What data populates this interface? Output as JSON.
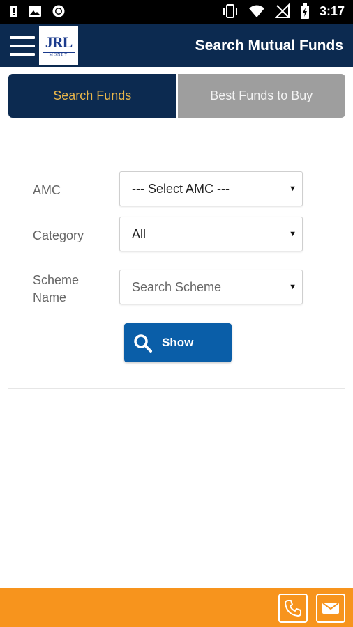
{
  "status_bar": {
    "time": "3:17",
    "left_icons": [
      "alert-icon",
      "image-icon",
      "circle-icon"
    ],
    "right_icons": [
      "vibrate-icon",
      "wifi-icon",
      "no-signal-icon",
      "battery-icon"
    ]
  },
  "header": {
    "logo_text": "JRL",
    "logo_subtext": "MONEY",
    "title": "Search Mutual Funds"
  },
  "tabs": [
    {
      "label": "Search Funds",
      "active": true
    },
    {
      "label": "Best Funds to Buy",
      "active": false
    }
  ],
  "form": {
    "amc": {
      "label": "AMC",
      "value": "--- Select AMC ---"
    },
    "category": {
      "label": "Category",
      "value": "All"
    },
    "scheme": {
      "label_line1": "Scheme",
      "label_line2": "Name",
      "placeholder": "Search Scheme"
    },
    "show_button": {
      "label": "Show",
      "icon": "search-icon"
    }
  },
  "footer": {
    "icons": [
      "phone-icon",
      "mail-icon"
    ]
  },
  "colors": {
    "header_bg": "#0c2a50",
    "tab_active_text": "#e9b64a",
    "tab_inactive_bg": "#9e9e9e",
    "button_bg": "#0a5ea8",
    "footer_bg": "#f7941d"
  }
}
